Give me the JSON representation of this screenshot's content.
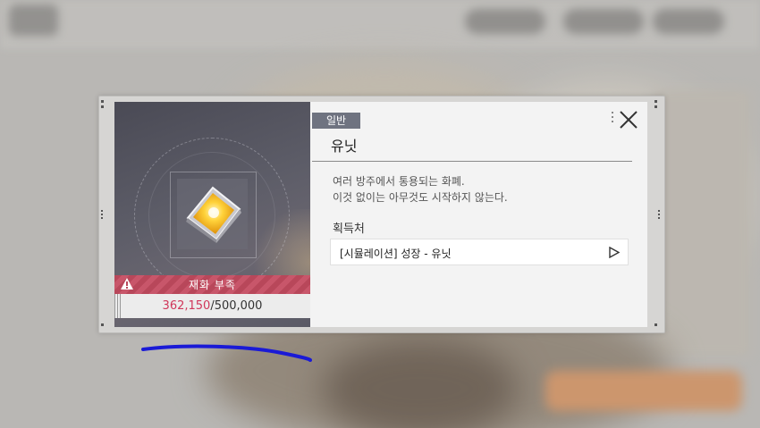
{
  "item": {
    "category_tag": "일반",
    "name": "유닛",
    "description_line1": "여러 방주에서 통용되는 화폐.",
    "description_line2": "이것 없이는 아무것도 시작하지 않는다.",
    "source_heading": "획득처",
    "source_entry": "[시뮬레이션] 성장 - 유닛"
  },
  "card": {
    "warning_text": "재화 부족",
    "current_amount": "362,150",
    "required_amount": "/500,000"
  },
  "colors": {
    "warning": "#c34f63",
    "current_amount": "#d0365a",
    "tag_bg": "#6f7380",
    "annotation_stroke": "#1a1ad6"
  },
  "icons": {
    "item": "gold-cube-icon",
    "warning": "warning-triangle-icon",
    "close": "close-x-icon",
    "go": "play-arrow-icon"
  }
}
